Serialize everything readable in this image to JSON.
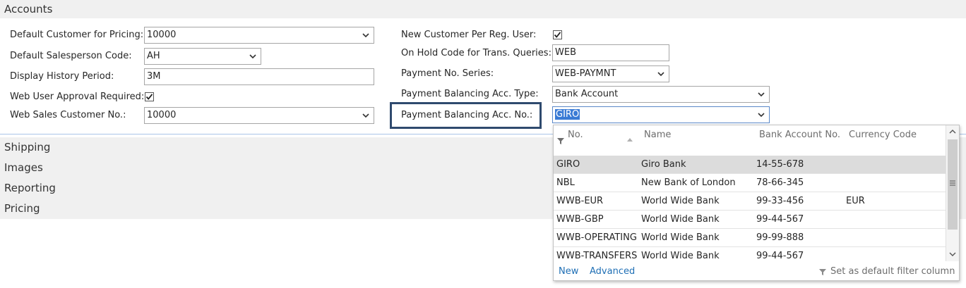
{
  "sections": {
    "accounts": "Accounts",
    "shipping": "Shipping",
    "images": "Images",
    "reporting": "Reporting",
    "pricing": "Pricing"
  },
  "left_fields": {
    "default_customer_label": "Default Customer for Pricing:",
    "default_customer_value": "10000",
    "salesperson_label": "Default Salesperson Code:",
    "salesperson_value": "AH",
    "history_label": "Display History Period:",
    "history_value": "3M",
    "approval_label": "Web User Approval Required:",
    "approval_checked": true,
    "web_sales_label": "Web Sales Customer No.:",
    "web_sales_value": "10000"
  },
  "right_fields": {
    "new_customer_label": "New Customer Per Reg. User:",
    "new_customer_checked": true,
    "on_hold_label": "On Hold Code for Trans. Queries:",
    "on_hold_value": "WEB",
    "payment_series_label": "Payment No. Series:",
    "payment_series_value": "WEB-PAYMNT",
    "bal_type_label": "Payment Balancing Acc. Type:",
    "bal_type_value": "Bank Account",
    "bal_no_label": "Payment Balancing Acc. No.:",
    "bal_no_value": "GIRO"
  },
  "lookup": {
    "columns": [
      "No.",
      "Name",
      "Bank Account No.",
      "Currency Code"
    ],
    "rows": [
      {
        "no": "GIRO",
        "name": "Giro Bank",
        "account": "14-55-678",
        "currency": ""
      },
      {
        "no": "NBL",
        "name": "New Bank of London",
        "account": "78-66-345",
        "currency": ""
      },
      {
        "no": "WWB-EUR",
        "name": "World Wide Bank",
        "account": "99-33-456",
        "currency": "EUR"
      },
      {
        "no": "WWB-GBP",
        "name": "World Wide Bank",
        "account": "99-44-567",
        "currency": ""
      },
      {
        "no": "WWB-OPERATING",
        "name": "World Wide Bank",
        "account": "99-99-888",
        "currency": ""
      },
      {
        "no": "WWB-TRANSFERS",
        "name": "World Wide Bank",
        "account": "99-44-567",
        "currency": ""
      }
    ],
    "selected_index": 0,
    "footer": {
      "new": "New",
      "advanced": "Advanced",
      "default_filter": "Set as default filter column"
    }
  },
  "colors": {
    "section_bg": "#f0f0f0",
    "focus_border": "#2f4a6e",
    "link": "#1f6fb5",
    "selection_highlight": "#3a7bd5"
  },
  "icons": [
    "chevron-down-icon",
    "checkbox-checked-icon",
    "filter-icon",
    "sort-up-icon",
    "scroll-up-icon",
    "scroll-down-icon",
    "scroll-grip-icon"
  ]
}
